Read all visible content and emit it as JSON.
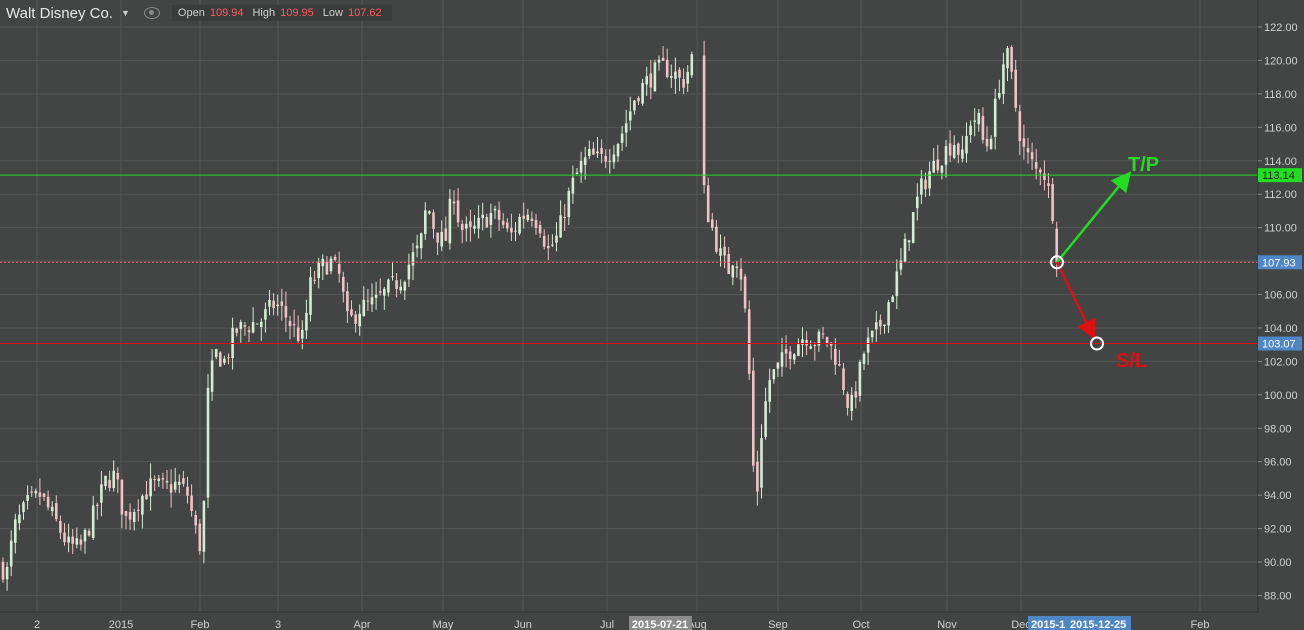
{
  "header": {
    "symbol": "Walt Disney Co.",
    "open_label": "Open",
    "open_value": "109.94",
    "high_label": "High",
    "high_value": "109.95",
    "low_label": "Low",
    "low_value": "107.62"
  },
  "colors": {
    "background": "#434444",
    "grid": "#555757",
    "axis_text": "#d0d0d0",
    "up_candle": "#d4ecd4",
    "down_candle": "#f0c2c6",
    "take_profit": "#22dd22",
    "stop_loss": "#dd1111",
    "entry": "#ff6060",
    "axis_badge_blue": "#4f86c6",
    "axis_badge_grey": "#8c8c8c"
  },
  "annotations": {
    "tp_label": "T/P",
    "sl_label": "S/L",
    "tp_price": "113.14",
    "entry_price": "107.93",
    "sl_price": "103.07"
  },
  "x_axis": {
    "labels": [
      "2",
      "2015",
      "Feb",
      "3",
      "Apr",
      "May",
      "Jun",
      "Jul",
      "Aug",
      "Sep",
      "Oct",
      "Nov",
      "Dec",
      "Feb"
    ],
    "crosshair_date": "2015-07-21",
    "range_left": "2015-1",
    "range_right": "2015-12-25"
  },
  "chart_data": {
    "type": "candlestick",
    "title": "Walt Disney Co.",
    "ylim": [
      87,
      123
    ],
    "y_ticks": [
      "88.00",
      "90.00",
      "92.00",
      "94.00",
      "96.00",
      "98.00",
      "100.00",
      "102.00",
      "104.00",
      "106.00",
      "108.00",
      "110.00",
      "112.00",
      "114.00",
      "116.00",
      "118.00",
      "120.00",
      "122.00"
    ],
    "horizontal_levels": [
      {
        "name": "T/P",
        "value": 113.14
      },
      {
        "name": "Entry",
        "value": 107.93
      },
      {
        "name": "S/L",
        "value": 103.07
      }
    ],
    "price_path": [
      [
        0,
        90.2
      ],
      [
        6,
        89.0
      ],
      [
        14,
        92.0
      ],
      [
        28,
        93.5
      ],
      [
        40,
        94.0
      ],
      [
        55,
        92.5
      ],
      [
        68,
        91.0
      ],
      [
        80,
        90.8
      ],
      [
        95,
        93.0
      ],
      [
        105,
        94.8
      ],
      [
        115,
        95.2
      ],
      [
        125,
        92.5
      ],
      [
        140,
        93.8
      ],
      [
        152,
        94.6
      ],
      [
        165,
        94.4
      ],
      [
        178,
        94.7
      ],
      [
        188,
        94.0
      ],
      [
        195,
        92.0
      ],
      [
        200,
        91.0
      ],
      [
        204,
        93.5
      ],
      [
        208,
        100.0
      ],
      [
        215,
        102.5
      ],
      [
        225,
        102.0
      ],
      [
        235,
        103.8
      ],
      [
        250,
        104.2
      ],
      [
        262,
        104.5
      ],
      [
        275,
        105.5
      ],
      [
        285,
        104.8
      ],
      [
        295,
        103.8
      ],
      [
        303,
        103.3
      ],
      [
        310,
        106.5
      ],
      [
        320,
        107.5
      ],
      [
        330,
        108.0
      ],
      [
        340,
        107.0
      ],
      [
        348,
        104.2
      ],
      [
        360,
        105.2
      ],
      [
        375,
        105.5
      ],
      [
        390,
        106.4
      ],
      [
        402,
        107.0
      ],
      [
        412,
        108.2
      ],
      [
        420,
        108.8
      ],
      [
        427,
        111.5
      ],
      [
        435,
        109.8
      ],
      [
        445,
        109.0
      ],
      [
        453,
        112.4
      ],
      [
        460,
        110.0
      ],
      [
        470,
        109.6
      ],
      [
        480,
        110.2
      ],
      [
        490,
        110.8
      ],
      [
        500,
        110.5
      ],
      [
        510,
        109.4
      ],
      [
        520,
        110.6
      ],
      [
        530,
        111.0
      ],
      [
        540,
        110.2
      ],
      [
        548,
        108.6
      ],
      [
        558,
        109.5
      ],
      [
        565,
        111.2
      ],
      [
        572,
        112.5
      ],
      [
        580,
        113.6
      ],
      [
        590,
        114.3
      ],
      [
        600,
        114.0
      ],
      [
        610,
        114.6
      ],
      [
        620,
        115.4
      ],
      [
        628,
        116.6
      ],
      [
        636,
        118.0
      ],
      [
        645,
        118.6
      ],
      [
        655,
        119.3
      ],
      [
        665,
        119.6
      ],
      [
        675,
        119.2
      ],
      [
        682,
        118.6
      ],
      [
        688,
        119.4
      ],
      [
        692,
        120.2
      ],
      [
        705,
        111.5
      ],
      [
        712,
        110.0
      ],
      [
        720,
        108.4
      ],
      [
        728,
        107.4
      ],
      [
        735,
        108.6
      ],
      [
        742,
        107.0
      ],
      [
        748,
        103.0
      ],
      [
        752,
        97.0
      ],
      [
        756,
        93.0
      ],
      [
        760,
        97.0
      ],
      [
        764,
        99.0
      ],
      [
        770,
        101.0
      ],
      [
        778,
        101.6
      ],
      [
        788,
        102.6
      ],
      [
        795,
        103.0
      ],
      [
        805,
        103.6
      ],
      [
        815,
        103.2
      ],
      [
        825,
        103.4
      ],
      [
        835,
        102.4
      ],
      [
        842,
        101.0
      ],
      [
        850,
        99.0
      ],
      [
        857,
        100.6
      ],
      [
        865,
        102.8
      ],
      [
        875,
        103.6
      ],
      [
        882,
        104.4
      ],
      [
        890,
        105.8
      ],
      [
        900,
        107.6
      ],
      [
        910,
        110.0
      ],
      [
        920,
        112.2
      ],
      [
        930,
        113.4
      ],
      [
        940,
        114.2
      ],
      [
        948,
        114.8
      ],
      [
        955,
        115.2
      ],
      [
        962,
        114.0
      ],
      [
        970,
        116.4
      ],
      [
        978,
        116.6
      ],
      [
        985,
        114.6
      ],
      [
        992,
        116.0
      ],
      [
        998,
        118.2
      ],
      [
        1003,
        119.8
      ],
      [
        1008,
        120.2
      ],
      [
        1014,
        118.0
      ],
      [
        1018,
        116.2
      ],
      [
        1024,
        114.6
      ],
      [
        1030,
        114.0
      ],
      [
        1036,
        113.4
      ],
      [
        1042,
        113.8
      ],
      [
        1047,
        112.6
      ],
      [
        1052,
        111.2
      ],
      [
        1057,
        109.9
      ],
      [
        1058,
        108.0
      ]
    ]
  }
}
